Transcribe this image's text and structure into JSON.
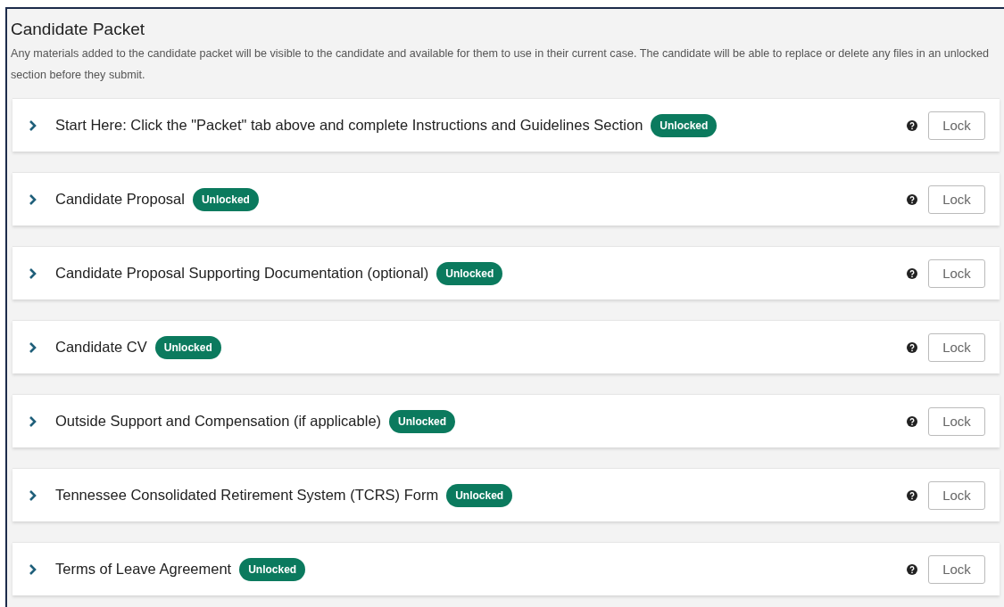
{
  "panel": {
    "title": "Candidate Packet",
    "description": "Any materials added to the candidate packet will be visible to the candidate and available for them to use in their current case. The candidate will be able to replace or delete any files in an unlocked section before they submit."
  },
  "sections": [
    {
      "title": "Start Here: Click the \"Packet\" tab above and complete Instructions and Guidelines Section",
      "status": "Unlocked",
      "expanded": false,
      "button": "Lock"
    },
    {
      "title": "Candidate Proposal",
      "status": "Unlocked",
      "expanded": false,
      "button": "Lock"
    },
    {
      "title": "Candidate Proposal Supporting Documentation (optional)",
      "status": "Unlocked",
      "expanded": false,
      "button": "Lock"
    },
    {
      "title": "Candidate CV",
      "status": "Unlocked",
      "expanded": false,
      "button": "Lock"
    },
    {
      "title": "Outside Support and Compensation (if applicable)",
      "status": "Unlocked",
      "expanded": false,
      "button": "Lock"
    },
    {
      "title": "Tennessee Consolidated Retirement System (TCRS) Form",
      "status": "Unlocked",
      "expanded": false,
      "button": "Lock"
    },
    {
      "title": "Terms of Leave Agreement",
      "status": "Unlocked",
      "expanded": false,
      "button": "Lock"
    }
  ]
}
